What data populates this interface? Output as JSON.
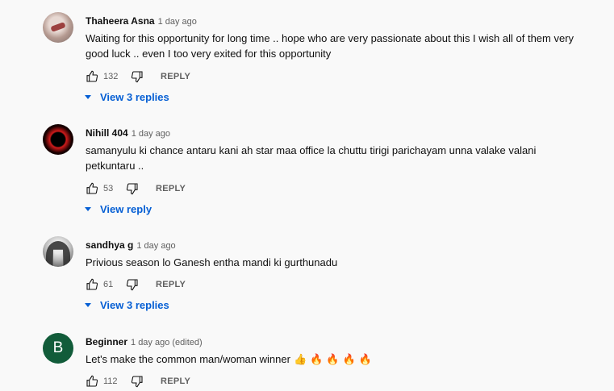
{
  "comments": [
    {
      "author": "Thaheera Asna",
      "time": "1 day ago",
      "text": "Waiting for this opportunity for long time .. hope  who are very passionate about this  I wish all of them very good luck .. even I too very exited for this opportunity",
      "likes": "132",
      "reply_label": "REPLY",
      "view_replies": "View 3 replies"
    },
    {
      "author": "Nihill 404",
      "time": "1 day ago",
      "text": "samanyulu ki chance antaru kani ah star maa office la chuttu tirigi parichayam unna valake valani petkuntaru ..",
      "likes": "53",
      "reply_label": "REPLY",
      "view_replies": "View reply"
    },
    {
      "author": "sandhya g",
      "time": "1 day ago",
      "text": "Privious season lo Ganesh entha mandi ki gurthunadu",
      "likes": "61",
      "reply_label": "REPLY",
      "view_replies": "View 3 replies"
    },
    {
      "author": "Beginner",
      "time": "1 day ago (edited)",
      "text": "Let's make the common man/woman winner",
      "emojis": [
        "👍",
        "🔥",
        "🔥",
        "🔥",
        "🔥"
      ],
      "avatar_letter": "B",
      "likes": "112",
      "reply_label": "REPLY"
    }
  ],
  "colors": {
    "background": "#f9f9f9",
    "link_blue": "#065fd4",
    "secondary_text": "#606060",
    "avatar_green": "#125c3a"
  },
  "icons": [
    "like-icon",
    "dislike-icon",
    "chevron-down-icon"
  ]
}
